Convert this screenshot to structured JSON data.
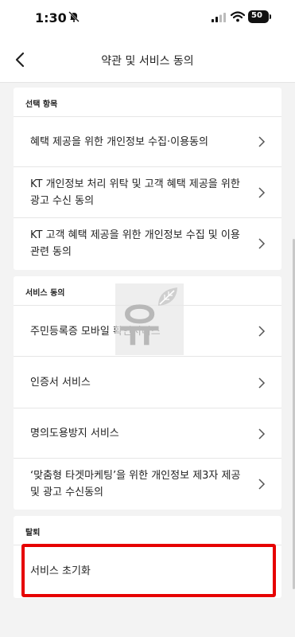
{
  "status_bar": {
    "time": "1:30",
    "battery": "50"
  },
  "header": {
    "title": "약관 및 서비스 동의"
  },
  "sections": [
    {
      "title": "선택 항목",
      "items": [
        "혜택 제공을 위한 개인정보 수집·이용동의",
        "KT 개인정보 처리 위탁 및 고객 혜택 제공을 위한 광고 수신 동의",
        "KT 고객 혜택 제공을 위한 개인정보 수집 및 이용 관련 동의"
      ]
    },
    {
      "title": "서비스 동의",
      "items": [
        "주민등록증 모바일 확인서비스",
        "인증서 서비스",
        "명의도용방지 서비스",
        "‘맞춤형 타겟마케팅’을 위한 개인정보 제3자 제공 및 광고 수신동의"
      ]
    },
    {
      "title": "탈퇴",
      "items": [
        "서비스 초기화"
      ]
    }
  ],
  "watermark": {
    "glyph": "유"
  },
  "colors": {
    "highlight": "#e60000",
    "background": "#f3f3f3"
  }
}
